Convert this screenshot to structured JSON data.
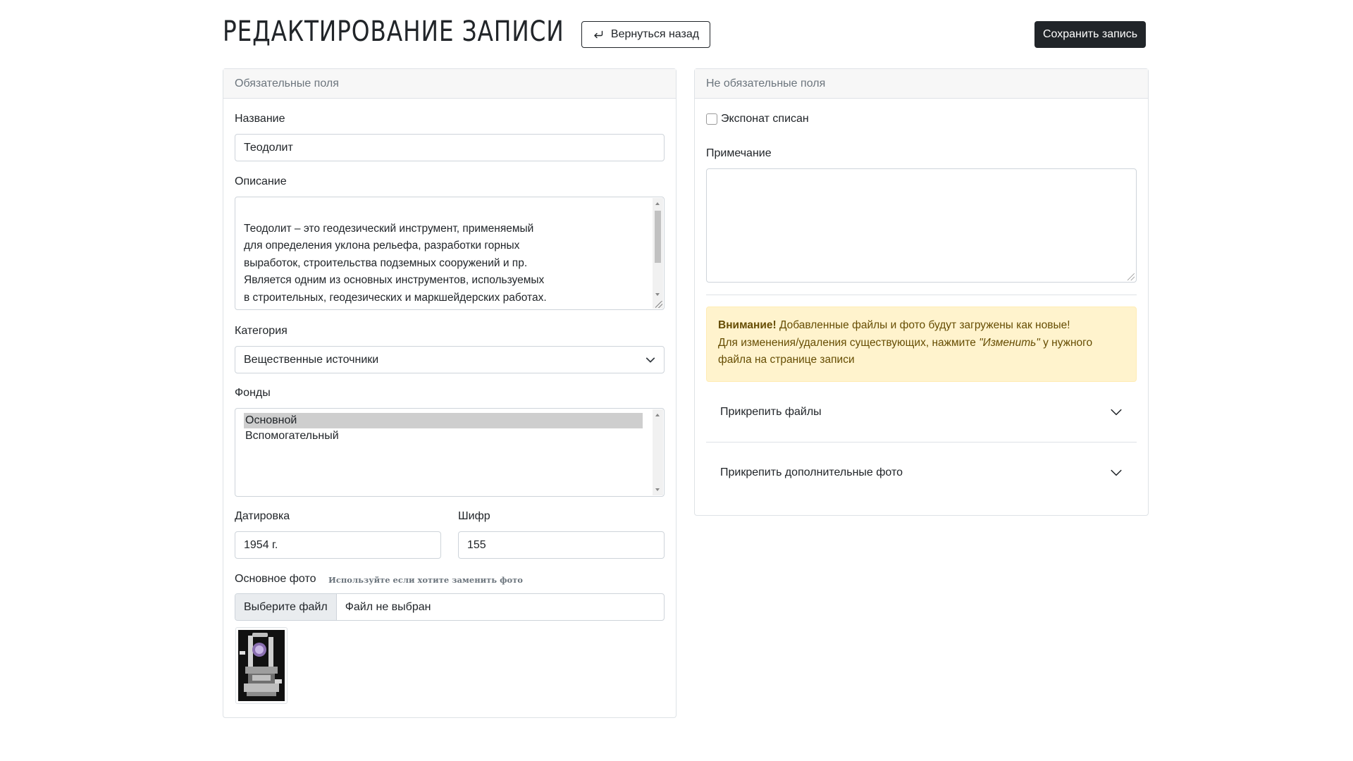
{
  "header": {
    "title": "РЕДАКТИРОВАНИЕ ЗАПИСИ",
    "back_label": "Вернуться назад",
    "save_label": "Сохранить запись"
  },
  "required": {
    "header": "Обязательные поля",
    "name_label": "Название",
    "name_value": "Теодолит",
    "description_label": "Описание",
    "description_value": "Теодолит – это геодезический инструмент, применяемый\nдля определения уклона рельефа, разработки горных\nвыработок, строительства подземных сооружений и пр.\nЯвляется одним из основных инструментов, используемых\nв строительных, геодезических и маркшейдерских работах.\nОсновной рабочей мерой в теодолите являются лимбы",
    "category_label": "Категория",
    "category_value": "Вещественные источники",
    "funds_label": "Фонды",
    "funds_options": [
      "Основной",
      "Вспомогательный"
    ],
    "dating_label": "Датировка",
    "dating_value": "1954 г.",
    "cipher_label": "Шифр",
    "cipher_value": "155",
    "photo_label": "Основное фото",
    "photo_hint": "Используйте если хотите заменить фото",
    "file_button": "Выберите файл",
    "file_status": "Файл не выбран"
  },
  "optional": {
    "header": "Не обязательные поля",
    "written_off_label": "Экспонат списан",
    "note_label": "Примечание",
    "note_value": "",
    "alert_strong": "Внимание!",
    "alert_line1": " Добавленные файлы и фото будут загружены как новые!",
    "alert_line2_pre": "Для изменения/удаления существующих, нажмите ",
    "alert_line2_em": "\"Изменить\"",
    "alert_line2_post": " у нужного файла на странице записи",
    "attach_files": "Прикрепить файлы",
    "attach_photos": "Прикрепить дополнительные фото"
  }
}
